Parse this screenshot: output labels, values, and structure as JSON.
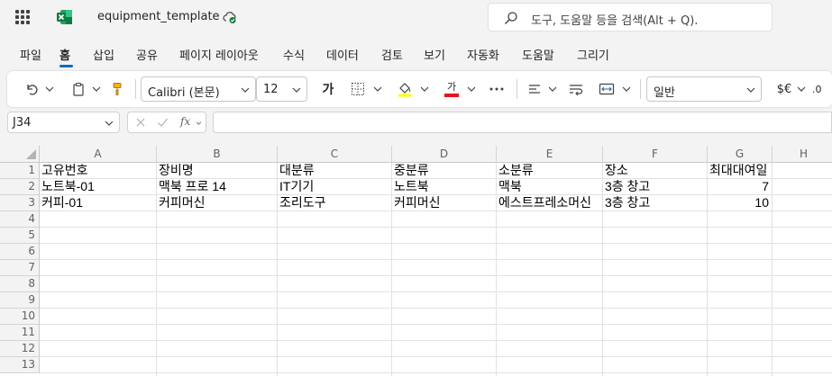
{
  "titlebar": {
    "doc_title": "equipment_template",
    "search_placeholder": "도구, 도움말 등을 검색(Alt + Q)."
  },
  "menu": {
    "items": [
      "파일",
      "홈",
      "삽입",
      "공유",
      "페이지 레이아웃",
      "수식",
      "데이터",
      "검토",
      "보기",
      "자동화",
      "도움말",
      "그리기"
    ],
    "active": "홈"
  },
  "ribbon": {
    "font_name": "Calibri (본문)",
    "font_size": "12",
    "bold_glyph": "가",
    "font_color_glyph": "가",
    "number_format": "일반",
    "currency_glyph": "$€",
    "decimal_glyph": ".0",
    "font_color": "#e81123"
  },
  "formula_bar": {
    "name_box": "J34",
    "fx_label": "fx",
    "formula": ""
  },
  "sheet": {
    "columns": [
      "A",
      "B",
      "C",
      "D",
      "E",
      "F",
      "G",
      "H"
    ],
    "rows": [
      "1",
      "2",
      "3",
      "4",
      "5",
      "6",
      "7",
      "8",
      "9",
      "10",
      "11",
      "12",
      "13"
    ],
    "cells": {
      "r1": [
        "고유번호",
        "장비명",
        "대분류",
        "중분류",
        "소분류",
        "장소",
        "최대대여일"
      ],
      "r2": [
        "노트북-01",
        "맥북 프로 14",
        "IT기기",
        "노트북",
        "맥북",
        "3층 창고",
        "7"
      ],
      "r3": [
        "커피-01",
        "커피머신",
        "조리도구",
        "커피머신",
        "에스트프레소머신",
        "3층 창고",
        "10"
      ]
    }
  }
}
